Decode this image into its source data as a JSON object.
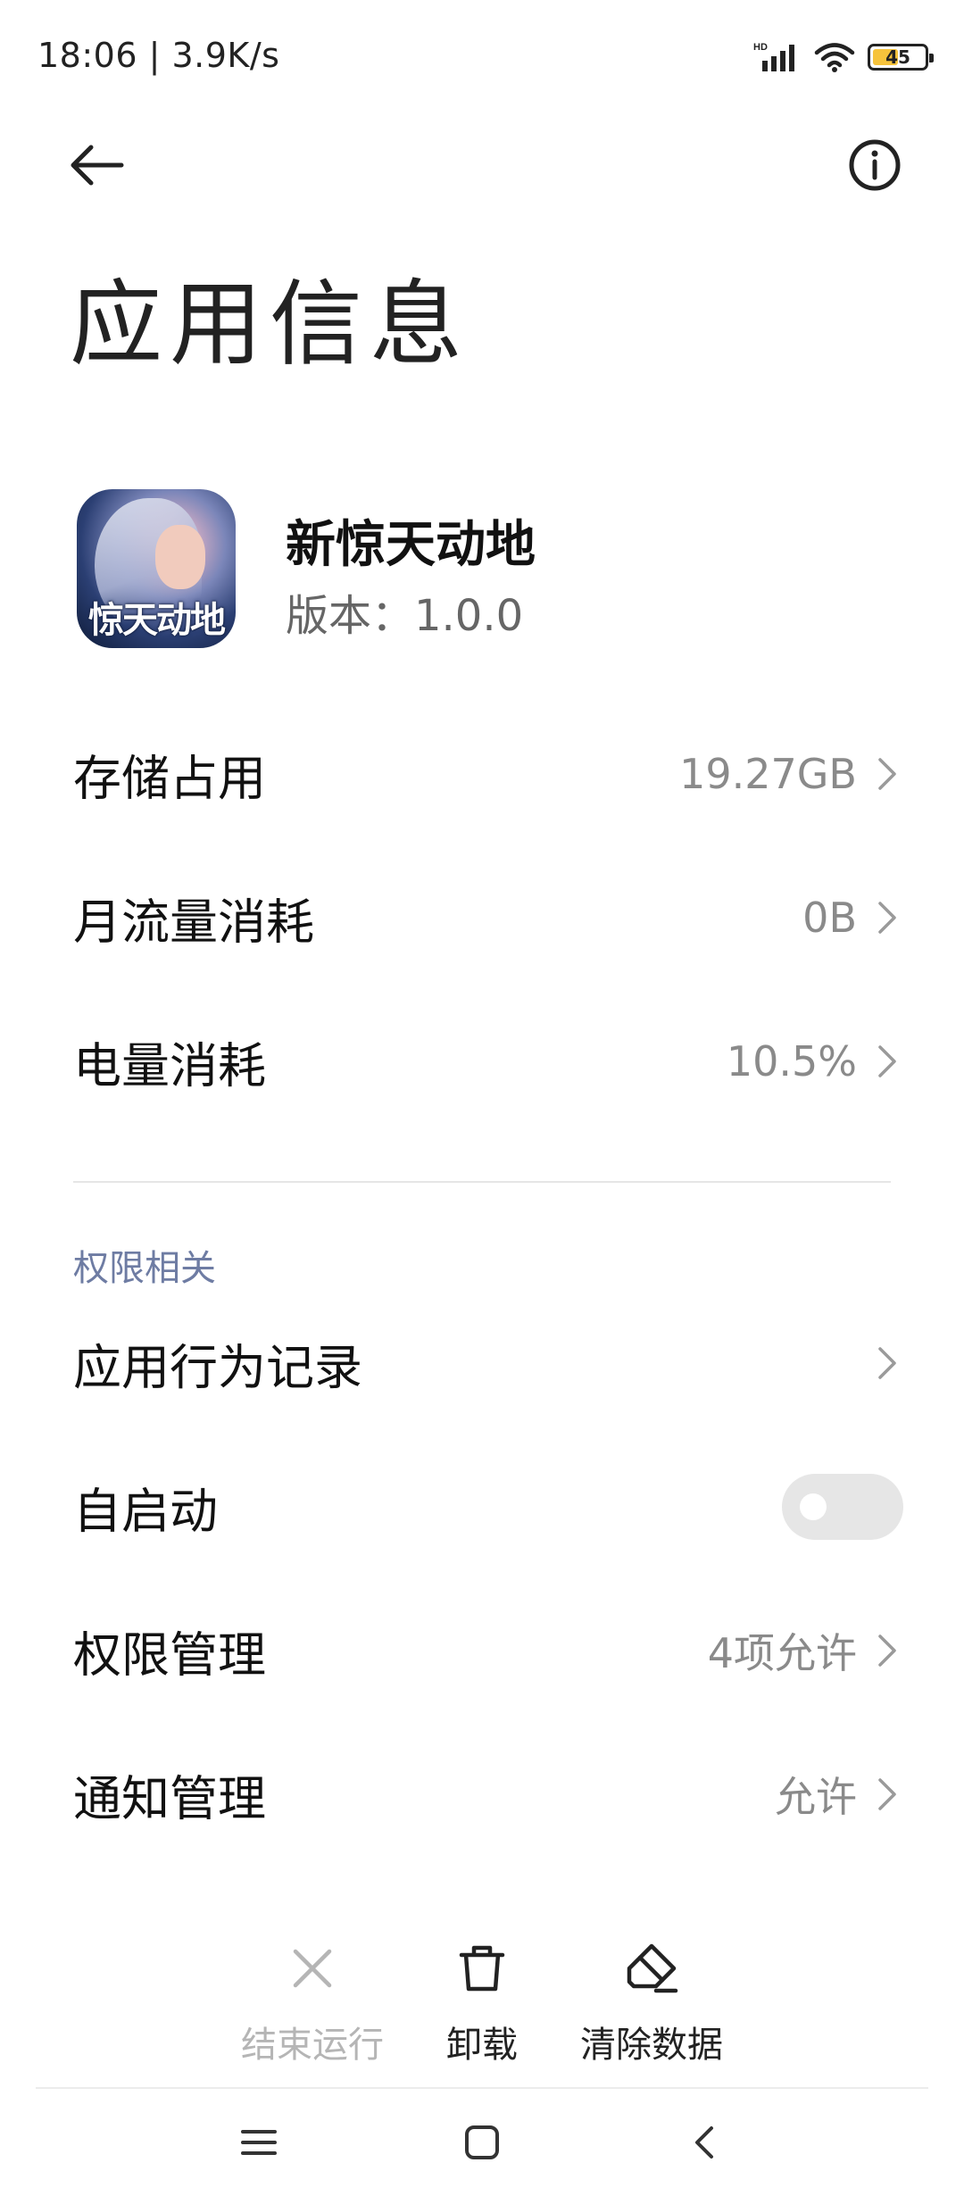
{
  "status_bar": {
    "time": "18:06 | 3.9K/s",
    "battery_level": "45",
    "network_badge": "HD",
    "icons": [
      "signal-icon",
      "wifi-icon",
      "battery-icon"
    ]
  },
  "header": {
    "back_icon": "back-arrow-icon",
    "info_icon": "info-icon",
    "title": "应用信息"
  },
  "app": {
    "name": "新惊天动地",
    "version": "版本：1.0.0",
    "icon_text": "惊天动地"
  },
  "usage_rows": [
    {
      "label": "存储占用",
      "value": "19.27GB"
    },
    {
      "label": "月流量消耗",
      "value": "0B"
    },
    {
      "label": "电量消耗",
      "value": "10.5%"
    }
  ],
  "permissions": {
    "section_title": "权限相关",
    "rows": [
      {
        "label": "应用行为记录",
        "value": ""
      },
      {
        "label": "自启动",
        "toggle_on": false
      },
      {
        "label": "权限管理",
        "value": "4项允许"
      },
      {
        "label": "通知管理",
        "value": "允许"
      }
    ]
  },
  "actions": [
    {
      "label": "结束运行",
      "icon": "close-icon",
      "enabled": false
    },
    {
      "label": "卸载",
      "icon": "trash-icon",
      "enabled": true
    },
    {
      "label": "清除数据",
      "icon": "eraser-icon",
      "enabled": true
    }
  ],
  "navbar": {
    "icons": [
      "menu-icon",
      "home-square-icon",
      "back-chevron-icon"
    ]
  },
  "colors": {
    "section_header": "#6e7ca3",
    "value_text": "#8a8a8a",
    "battery_fill": "#f6c33c",
    "disabled_text": "#b5b5b5"
  }
}
